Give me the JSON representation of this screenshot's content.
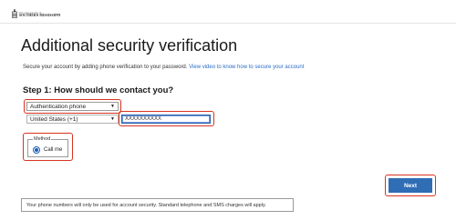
{
  "header": {
    "logo_small": "THE UNIVERSITY OF",
    "logo_big": "SOUTHERN MISSISSIPPI"
  },
  "page": {
    "title": "Additional security verification",
    "intro_text": "Secure your account by adding phone verification to your password.",
    "intro_link": "View video to know how to secure your account"
  },
  "step1": {
    "title": "Step 1: How should we contact you?",
    "contact_method": "Authentication phone",
    "country": "United States (+1)",
    "phone_value": "XXXXXXXXXX",
    "method_legend": "Method",
    "method_option": "Call me"
  },
  "actions": {
    "next_label": "Next"
  },
  "notice": "Your phone numbers will only be used for account security. Standard telephone and SMS charges will apply.",
  "colors": {
    "accent": "#2f6db5",
    "highlight": "#d9331f",
    "link": "#2b6cc4"
  }
}
